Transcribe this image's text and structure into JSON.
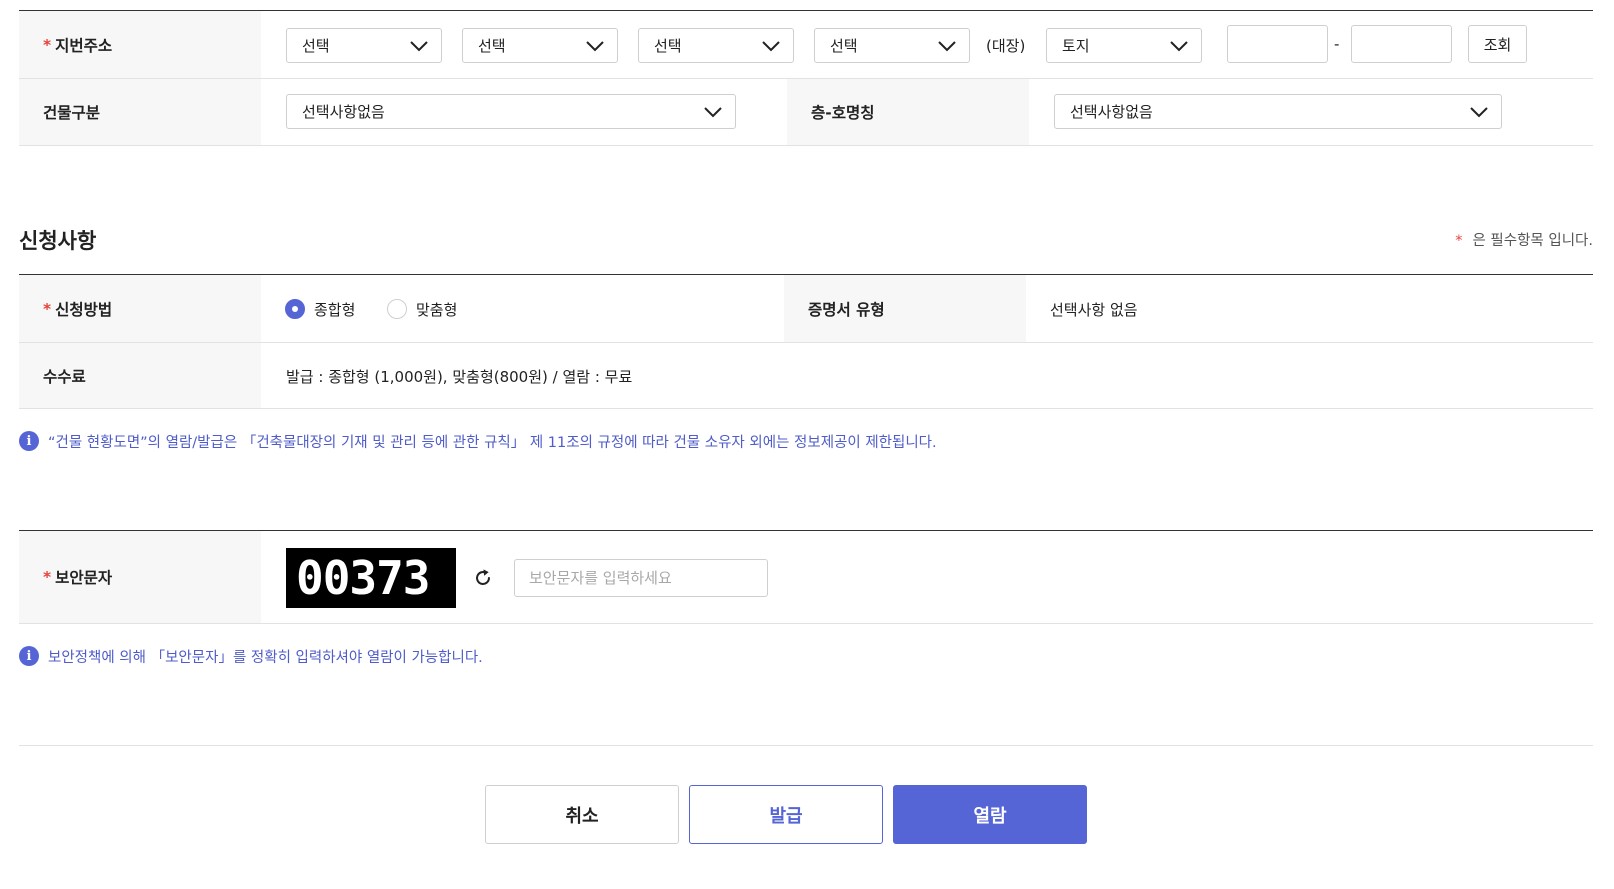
{
  "address": {
    "label": "지번주소",
    "required_mark": "*",
    "selects": [
      "선택",
      "선택",
      "선택",
      "선택"
    ],
    "ledger_label": "(대장)",
    "ledger_type": "토지",
    "lot_main": "",
    "lot_separator": "-",
    "lot_sub": "",
    "search_button": "조회"
  },
  "building": {
    "type_label": "건물구분",
    "type_value": "선택사항없음",
    "floor_label": "층-호명칭",
    "floor_value": "선택사항없음"
  },
  "application": {
    "section_title": "신청사항",
    "required_note_mark": "*",
    "required_note": "은 필수항목 입니다.",
    "method_label": "신청방법",
    "method_options": [
      "종합형",
      "맞춤형"
    ],
    "method_selected": "종합형",
    "cert_type_label": "증명서 유형",
    "cert_type_value": "선택사항 없음",
    "fee_label": "수수료",
    "fee_value": "발급 : 종합형 (1,000원), 맞춤형(800원) / 열람 : 무료",
    "info_text": "“건물 현황도면”의 열람/발급은 「건축물대장의 기재 및 관리 등에 관한 규칙」 제 11조의 규정에 따라 건물 소유자 외에는 정보제공이 제한됩니다."
  },
  "security": {
    "label": "보안문자",
    "captcha_text": "00373",
    "input_placeholder": "보안문자를 입력하세요",
    "input_value": "",
    "info_text": "보안정책에 의해 「보안문자」를 정확히 입력하셔야 열람이 가능합니다."
  },
  "actions": {
    "cancel": "취소",
    "issue": "발급",
    "view": "열람"
  },
  "colors": {
    "accent": "#5665d6",
    "required": "#e8413a",
    "info_text": "#4f5cc9",
    "header_bg": "#f7f7f7"
  },
  "icons": [
    "chevron-down-icon",
    "info-icon",
    "refresh-icon"
  ]
}
